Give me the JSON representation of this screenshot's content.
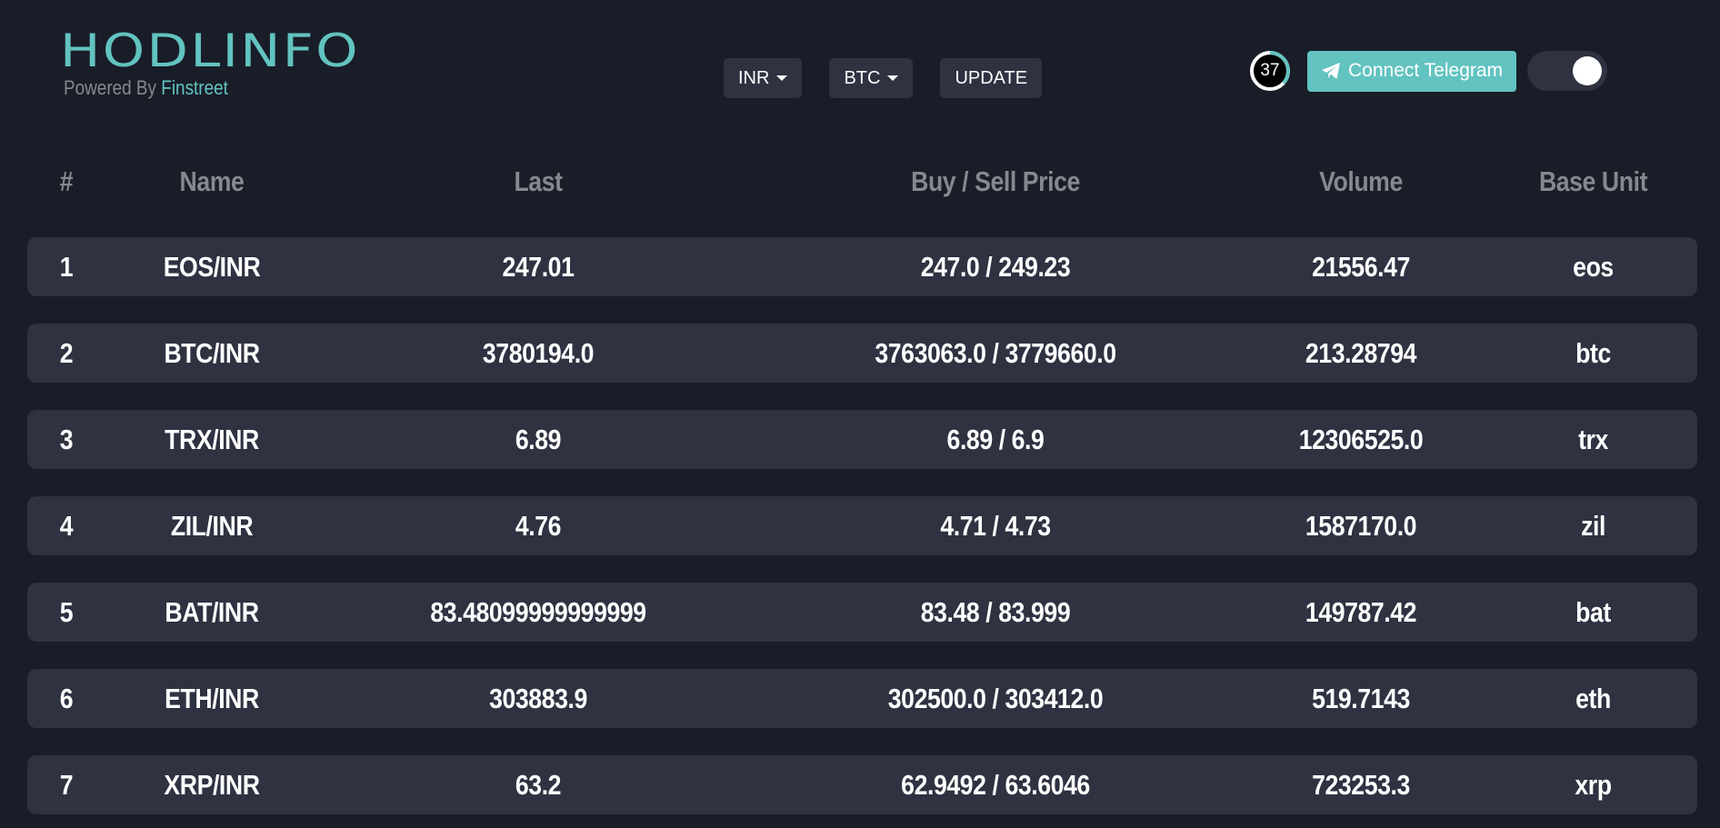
{
  "brand": {
    "logo": "HODLINFO",
    "powered_by": "Powered By",
    "powered_by_name": "Finstreet"
  },
  "controls": {
    "currency": "INR",
    "crypto": "BTC",
    "update_label": "UPDATE"
  },
  "timer": {
    "value": "37"
  },
  "telegram": {
    "label": "Connect Telegram"
  },
  "colors": {
    "background": "#191d28",
    "row": "#2e3241",
    "accent": "#62c3c0",
    "muted": "#86888f"
  },
  "table": {
    "headers": [
      "#",
      "Name",
      "Last",
      "Buy / Sell Price",
      "Volume",
      "Base Unit"
    ],
    "rows": [
      {
        "idx": "1",
        "name": "EOS/INR",
        "last": "247.01",
        "buy_sell": "247.0 / 249.23",
        "volume": "21556.47",
        "base": "eos"
      },
      {
        "idx": "2",
        "name": "BTC/INR",
        "last": "3780194.0",
        "buy_sell": "3763063.0 / 3779660.0",
        "volume": "213.28794",
        "base": "btc"
      },
      {
        "idx": "3",
        "name": "TRX/INR",
        "last": "6.89",
        "buy_sell": "6.89 / 6.9",
        "volume": "12306525.0",
        "base": "trx"
      },
      {
        "idx": "4",
        "name": "ZIL/INR",
        "last": "4.76",
        "buy_sell": "4.71 / 4.73",
        "volume": "1587170.0",
        "base": "zil"
      },
      {
        "idx": "5",
        "name": "BAT/INR",
        "last": "83.48099999999999",
        "buy_sell": "83.48 / 83.999",
        "volume": "149787.42",
        "base": "bat"
      },
      {
        "idx": "6",
        "name": "ETH/INR",
        "last": "303883.9",
        "buy_sell": "302500.0 / 303412.0",
        "volume": "519.7143",
        "base": "eth"
      },
      {
        "idx": "7",
        "name": "XRP/INR",
        "last": "63.2",
        "buy_sell": "62.9492 / 63.6046",
        "volume": "723253.3",
        "base": "xrp"
      }
    ]
  }
}
